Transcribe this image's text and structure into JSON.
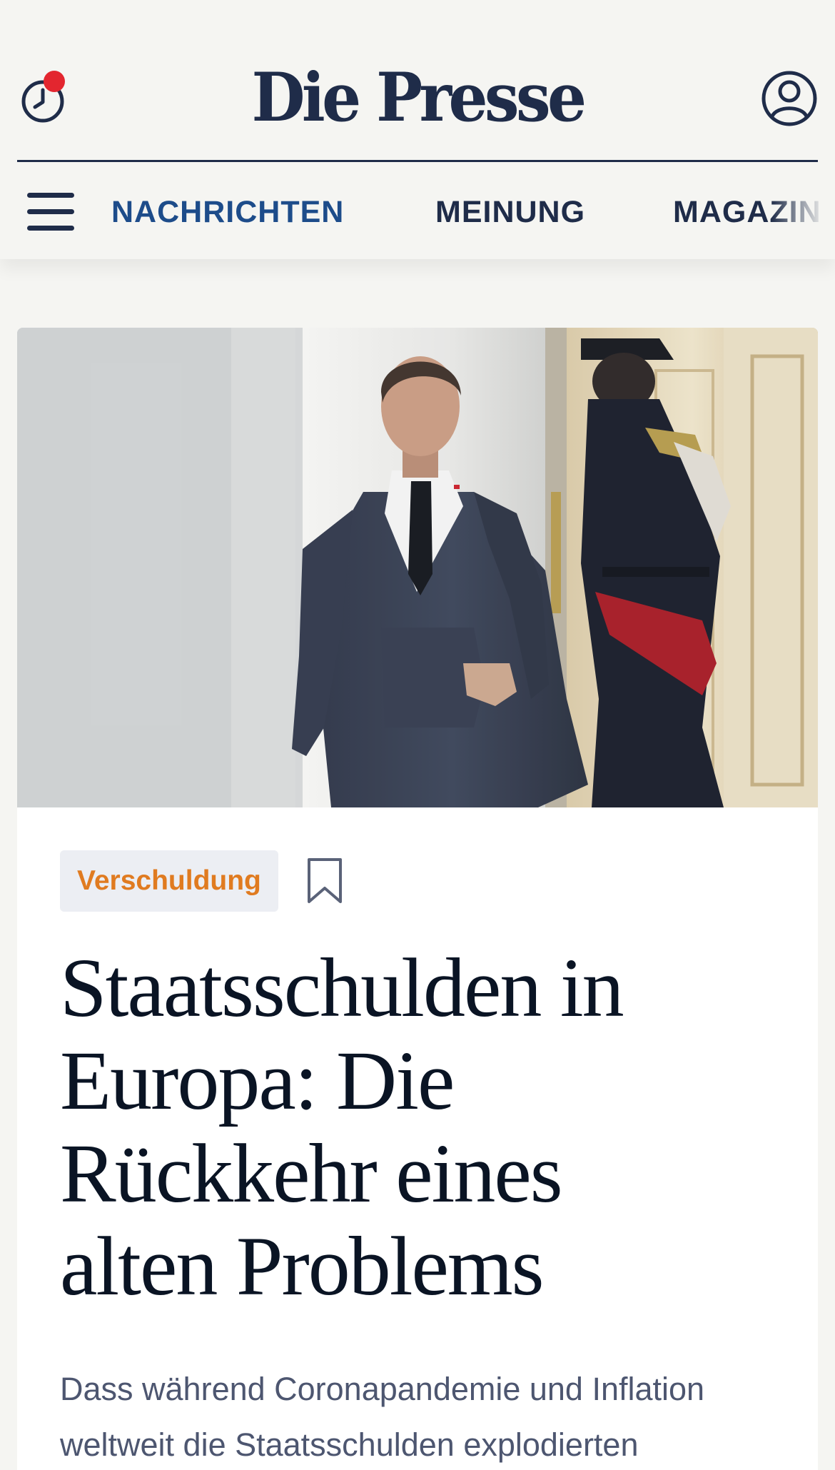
{
  "header": {
    "logo": "Die Presse",
    "history_icon": "clock-icon",
    "notification_dot_color": "#e3262f",
    "account_icon": "user-circle-icon"
  },
  "nav": {
    "menu_icon": "hamburger-menu-icon",
    "items": [
      {
        "label": "NACHRICHTEN",
        "active": true
      },
      {
        "label": "MEINUNG",
        "active": false
      },
      {
        "label": "MAGAZIN",
        "active": false
      }
    ]
  },
  "article": {
    "image_alt": "Mann im dunklen Dreiteiler geht durch einen hellen Gang, im Hintergrund ein Gardist in Uniform",
    "tag": "Verschuldung",
    "bookmark_icon": "bookmark-icon",
    "headline": "Staatsschulden in Europa: Die Rückkehr eines alten Problems",
    "lead": "Dass während Coronapandemie und Inflation weltweit die Staatsschulden explodierten"
  },
  "colors": {
    "brand_navy": "#1f2c49",
    "nav_active": "#1d4c8a",
    "tag_text": "#e07b20",
    "tag_bg": "#eceef3",
    "page_bg": "#f5f5f2",
    "lead_text": "#4d5670"
  }
}
